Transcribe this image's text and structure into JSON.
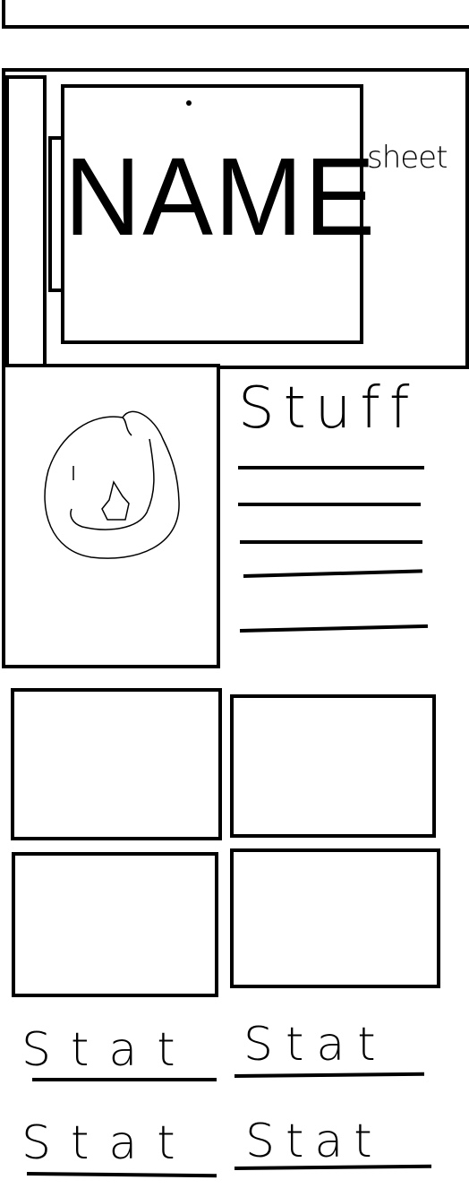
{
  "header": {
    "name": "NAME",
    "sheet_label": "sheet"
  },
  "portrait": {
    "icon": "flame-icon"
  },
  "stuff": {
    "heading": "Stuff",
    "line_count": 5
  },
  "stat_boxes": {
    "count": 4
  },
  "stats": [
    {
      "label": "Stat"
    },
    {
      "label": "Stat"
    },
    {
      "label": "Stat"
    },
    {
      "label": "Stat"
    }
  ]
}
